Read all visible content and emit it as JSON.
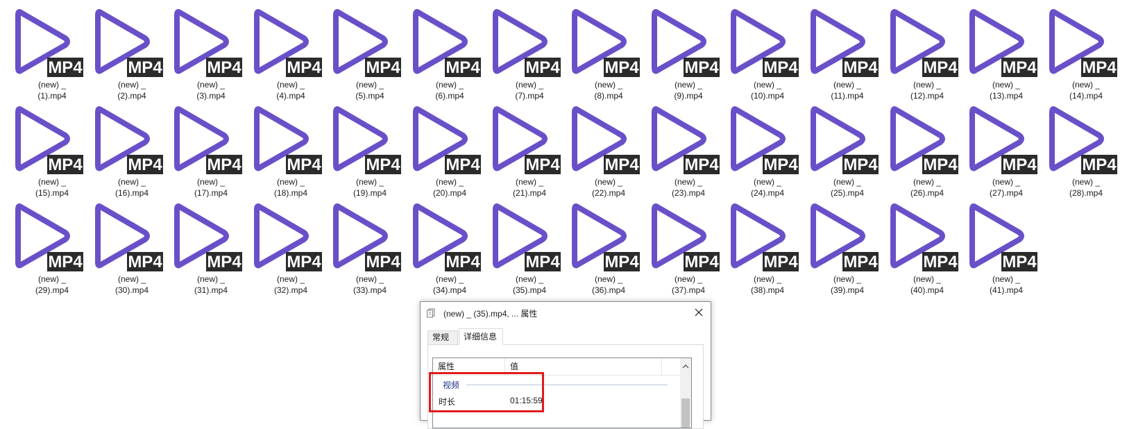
{
  "files": [
    {
      "line1": "(new) _",
      "line2": "(1).mp4"
    },
    {
      "line1": "(new) _",
      "line2": "(2).mp4"
    },
    {
      "line1": "(new) _",
      "line2": "(3).mp4"
    },
    {
      "line1": "(new) _",
      "line2": "(4).mp4"
    },
    {
      "line1": "(new) _",
      "line2": "(5).mp4"
    },
    {
      "line1": "(new) _",
      "line2": "(6).mp4"
    },
    {
      "line1": "(new) _",
      "line2": "(7).mp4"
    },
    {
      "line1": "(new) _",
      "line2": "(8).mp4"
    },
    {
      "line1": "(new) _",
      "line2": "(9).mp4"
    },
    {
      "line1": "(new) _",
      "line2": "(10).mp4"
    },
    {
      "line1": "(new) _",
      "line2": "(11).mp4"
    },
    {
      "line1": "(new) _",
      "line2": "(12).mp4"
    },
    {
      "line1": "(new) _",
      "line2": "(13).mp4"
    },
    {
      "line1": "(new) _",
      "line2": "(14).mp4"
    },
    {
      "line1": "(new) _",
      "line2": "(15).mp4"
    },
    {
      "line1": "(new) _",
      "line2": "(16).mp4"
    },
    {
      "line1": "(new) _",
      "line2": "(17).mp4"
    },
    {
      "line1": "(new) _",
      "line2": "(18).mp4"
    },
    {
      "line1": "(new) _",
      "line2": "(19).mp4"
    },
    {
      "line1": "(new) _",
      "line2": "(20).mp4"
    },
    {
      "line1": "(new) _",
      "line2": "(21).mp4"
    },
    {
      "line1": "(new) _",
      "line2": "(22).mp4"
    },
    {
      "line1": "(new) _",
      "line2": "(23).mp4"
    },
    {
      "line1": "(new) _",
      "line2": "(24).mp4"
    },
    {
      "line1": "(new) _",
      "line2": "(25).mp4"
    },
    {
      "line1": "(new) _",
      "line2": "(26).mp4"
    },
    {
      "line1": "(new) _",
      "line2": "(27).mp4"
    },
    {
      "line1": "(new) _",
      "line2": "(28).mp4"
    },
    {
      "line1": "(new) _",
      "line2": "(29).mp4"
    },
    {
      "line1": "(new) _",
      "line2": "(30).mp4"
    },
    {
      "line1": "(new) _",
      "line2": "(31).mp4"
    },
    {
      "line1": "(new) _",
      "line2": "(32).mp4"
    },
    {
      "line1": "(new) _",
      "line2": "(33).mp4"
    },
    {
      "line1": "(new) _",
      "line2": "(34).mp4"
    },
    {
      "line1": "(new) _",
      "line2": "(35).mp4"
    },
    {
      "line1": "(new) _",
      "line2": "(36).mp4"
    },
    {
      "line1": "(new) _",
      "line2": "(37).mp4"
    },
    {
      "line1": "(new) _",
      "line2": "(38).mp4"
    },
    {
      "line1": "(new) _",
      "line2": "(39).mp4"
    },
    {
      "line1": "(new) _",
      "line2": "(40).mp4"
    },
    {
      "line1": "(new) _",
      "line2": "(41).mp4"
    }
  ],
  "file_icon": {
    "name": "mp4-play-icon",
    "badge": "MP4",
    "play_color": "#6a50c8",
    "badge_color": "#2b2b2b"
  },
  "dialog": {
    "title": "(new) _ (35).mp4, ... 属性",
    "tabs": [
      "常规",
      "详细信息"
    ],
    "active_tab": "详细信息",
    "columns": {
      "property": "属性",
      "value": "值"
    },
    "group": "视频",
    "rows": [
      {
        "name": "时长",
        "value": "01:15:59"
      }
    ]
  },
  "colors": {
    "highlight": "#e11a1a",
    "group_text": "#1e3287"
  }
}
